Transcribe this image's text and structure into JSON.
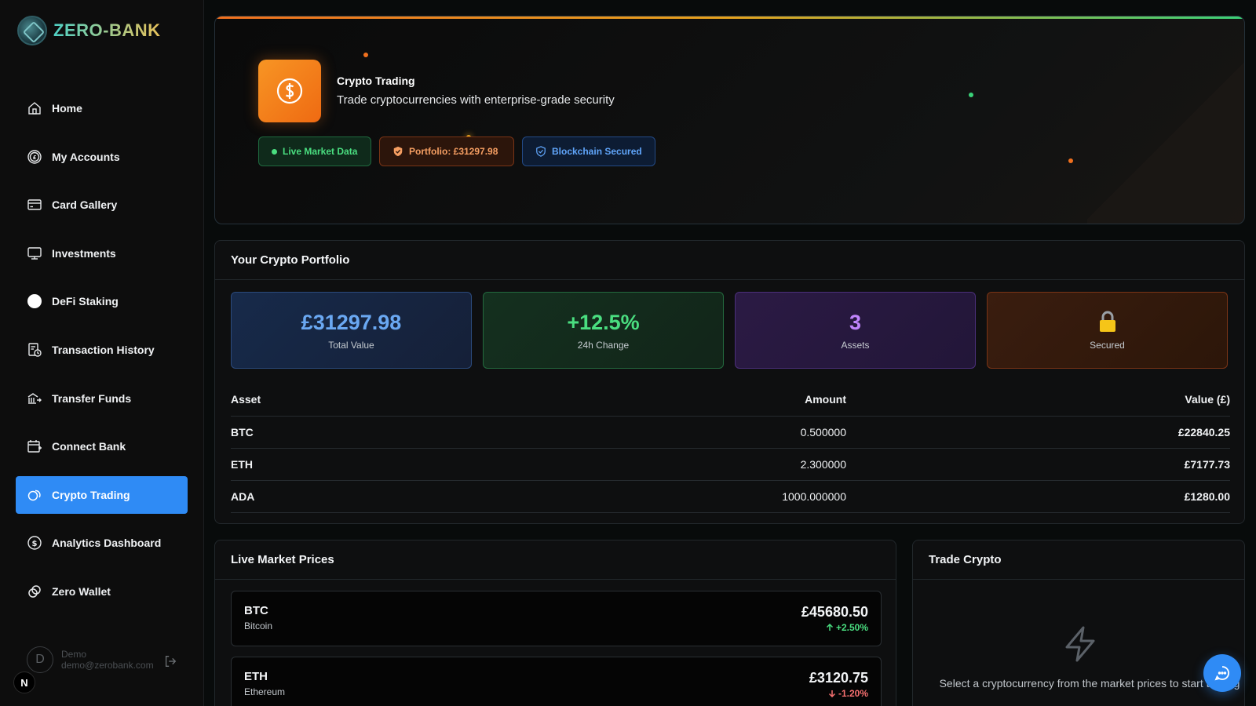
{
  "brand": {
    "name": "ZERO-BANK"
  },
  "sidebar": {
    "items": [
      {
        "label": "Home",
        "icon": "home-icon"
      },
      {
        "label": "My Accounts",
        "icon": "pound-coin-icon"
      },
      {
        "label": "Card Gallery",
        "icon": "credit-card-icon"
      },
      {
        "label": "Investments",
        "icon": "monitor-icon"
      },
      {
        "label": "DeFi Staking",
        "icon": "circle-icon"
      },
      {
        "label": "Transaction History",
        "icon": "history-icon"
      },
      {
        "label": "Transfer Funds",
        "icon": "transfer-icon"
      },
      {
        "label": "Connect Bank",
        "icon": "connect-bank-icon"
      },
      {
        "label": "Crypto Trading",
        "icon": "crypto-coins-icon",
        "active": true
      },
      {
        "label": "Analytics Dashboard",
        "icon": "dollar-coin-icon"
      },
      {
        "label": "Zero Wallet",
        "icon": "link-icon"
      }
    ],
    "user": {
      "initial": "D",
      "name": "Demo",
      "email": "demo@zerobank.com"
    },
    "badge": "N"
  },
  "hero": {
    "title": "Crypto Trading",
    "subtitle": "Trade cryptocurrencies with enterprise-grade security",
    "pills": {
      "live": "Live Market Data",
      "portfolio": "Portfolio: £31297.98",
      "chain": "Blockchain Secured"
    }
  },
  "portfolio": {
    "title": "Your Crypto Portfolio",
    "stats": {
      "total_value": "£31297.98",
      "total_label": "Total Value",
      "change_value": "+12.5%",
      "change_label": "24h Change",
      "assets_value": "3",
      "assets_label": "Assets",
      "secured_label": "Secured"
    },
    "columns": {
      "asset": "Asset",
      "amount": "Amount",
      "value": "Value (£)"
    },
    "rows": [
      {
        "asset": "BTC",
        "amount": "0.500000",
        "value": "£22840.25"
      },
      {
        "asset": "ETH",
        "amount": "2.300000",
        "value": "£7177.73"
      },
      {
        "asset": "ADA",
        "amount": "1000.000000",
        "value": "£1280.00"
      }
    ]
  },
  "market": {
    "title": "Live Market Prices",
    "items": [
      {
        "symbol": "BTC",
        "name": "Bitcoin",
        "price": "£45680.50",
        "change": "+2.50%"
      },
      {
        "symbol": "ETH",
        "name": "Ethereum",
        "price": "£3120.75",
        "change": "-1.20%"
      }
    ]
  },
  "trade": {
    "title": "Trade Crypto",
    "message": "Select a cryptocurrency from the market prices to start trading"
  },
  "colors": {
    "accent": "#2f8bf5",
    "positive": "#4ade80",
    "negative": "#f87171",
    "orange": "#f0701e"
  }
}
